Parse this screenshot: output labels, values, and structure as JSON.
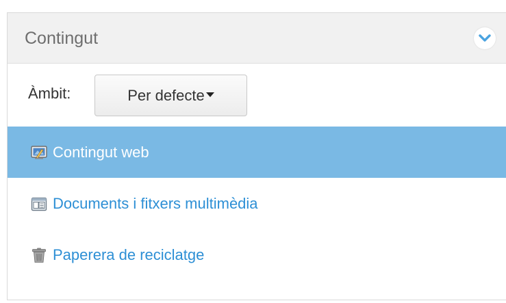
{
  "panel": {
    "title": "Contingut",
    "toggle_icon": "chevron-down-icon"
  },
  "scope": {
    "label": "Àmbit:",
    "selected": "Per defecte"
  },
  "nav": {
    "items": [
      {
        "label": "Contingut web",
        "icon": "web-content-icon",
        "active": true
      },
      {
        "label": "Documents i fitxers multimèdia",
        "icon": "documents-media-icon",
        "active": false
      },
      {
        "label": "Paperera de reciclatge",
        "icon": "recycle-bin-icon",
        "active": false
      }
    ]
  },
  "colors": {
    "accent": "#7ab9e4",
    "link": "#2d8fd5",
    "toggle_icon": "#4aa3e0"
  }
}
